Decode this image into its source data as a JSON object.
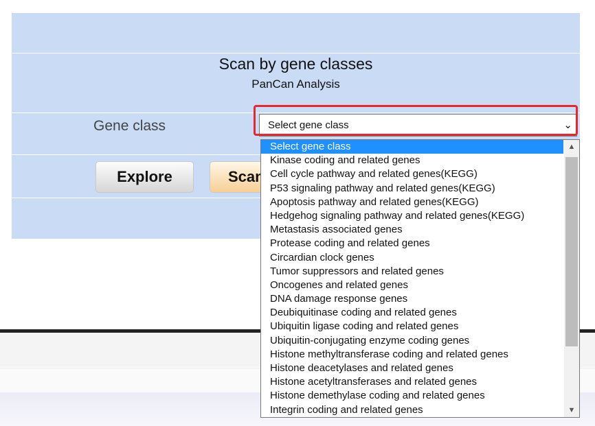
{
  "panel": {
    "title": "Scan by gene classes",
    "subtitle": "PanCan Analysis",
    "gene_class_label": "Gene class"
  },
  "buttons": {
    "explore": "Explore",
    "scan": "Scan"
  },
  "select": {
    "value": "Select gene class",
    "arrow": "⌄"
  },
  "dropdown": {
    "options": [
      "Select gene class",
      "Kinase coding and related genes",
      "Cell cycle pathway and related genes(KEGG)",
      "P53 signaling pathway and related genes(KEGG)",
      "Apoptosis pathway and related genes(KEGG)",
      "Hedgehog signaling pathway and related genes(KEGG)",
      "Metastasis associated genes",
      "Protease coding and related genes",
      "Circardian clock genes",
      "Tumor suppressors and related genes",
      "Oncogenes and related genes",
      "DNA damage response genes",
      "Deubiquitinase coding and related genes",
      "Ubiquitin ligase coding and related genes",
      "Ubiquitin-conjugating enzyme coding genes",
      "Histone methyltransferase coding and related genes",
      "Histone deacetylases and related genes",
      "Histone acetyltransferases and related genes",
      "Histone demethylase coding and related genes",
      "Integrin coding and related genes"
    ],
    "selected_index": 0,
    "scroll_up_icon": "▲",
    "scroll_down_icon": "▼"
  },
  "colors": {
    "panel_bg": "#c9dbf5",
    "highlight_border": "#e8262b",
    "selected_option": "#1e90ff"
  }
}
